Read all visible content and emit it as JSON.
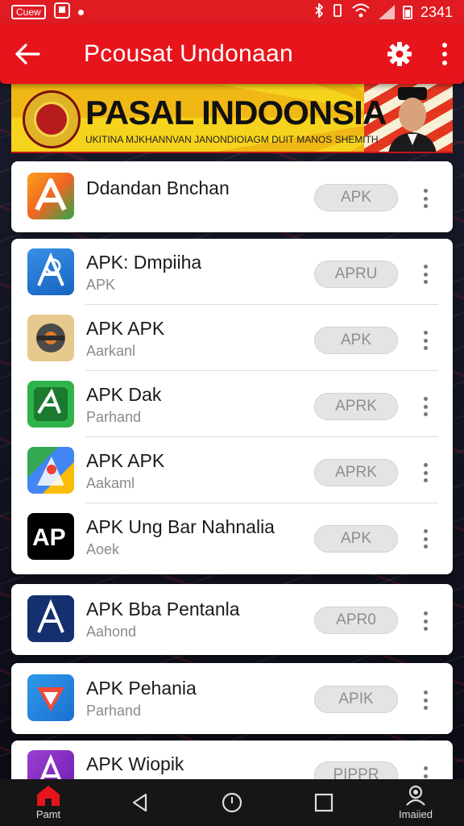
{
  "status_bar": {
    "left_label": "Cuew",
    "time": "2341"
  },
  "app_bar": {
    "title": "Pcousat Undonaan"
  },
  "banner": {
    "headline": "PASAL INDOONSIA",
    "subtitle": "UKITINA MJKHANNVAN JANONDIOIAGM DUIT MANOS SHEMITH"
  },
  "featured": {
    "name": "Ddandan Bnchan",
    "button": "APK"
  },
  "list1": [
    {
      "name": "APK: Dmpiiha",
      "sub": "APK",
      "button": "APRU",
      "icon": "apk-icon-blue"
    },
    {
      "name": "APK APK",
      "sub": "Aarkanl",
      "button": "APK",
      "icon": "apk-icon-gear"
    },
    {
      "name": "APK Dak",
      "sub": "Parhand",
      "button": "APRK",
      "icon": "apk-icon-green"
    },
    {
      "name": "APK APK",
      "sub": "Aakaml",
      "button": "APRK",
      "icon": "apk-icon-maps"
    },
    {
      "name": "APK Ung Bar Nahnalia",
      "sub": "Aoek",
      "button": "APK",
      "icon": "apk-icon-ap-black"
    }
  ],
  "list2": [
    {
      "name": "APK Bba Pentanla",
      "sub": "Aahond",
      "button": "APR0",
      "icon": "apk-icon-navy"
    }
  ],
  "list3": [
    {
      "name": "APK Pehania",
      "sub": "Parhand",
      "button": "APIK",
      "icon": "apk-icon-red-blue"
    }
  ],
  "list4": [
    {
      "name": "APK Wiopik",
      "sub": "",
      "button": "PIPPR",
      "icon": "apk-icon-purple"
    }
  ],
  "nav": {
    "home_label": "Pamt",
    "profile_label": "Imaiied"
  },
  "colors": {
    "primary_red": "#e8141b",
    "button_gray": "#e4e4e4",
    "banner_yellow": "#f6d31c"
  }
}
